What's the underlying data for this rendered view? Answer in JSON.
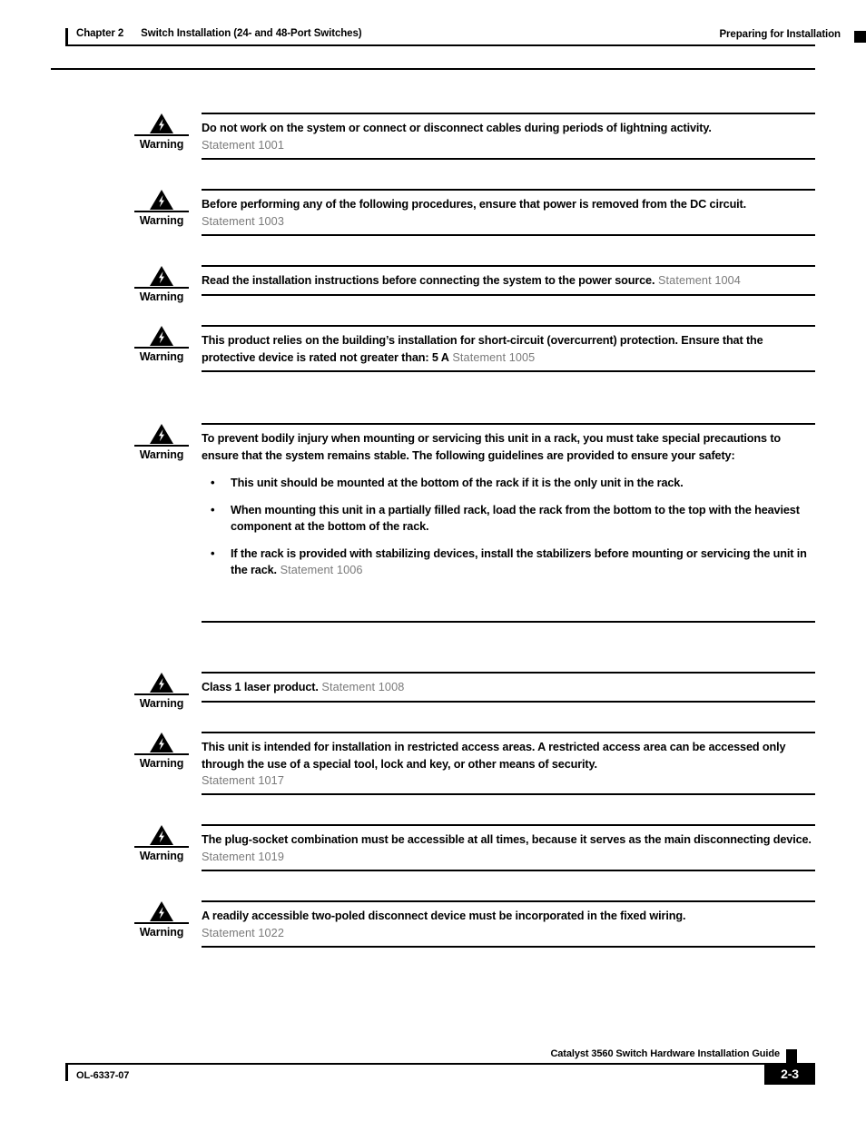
{
  "header": {
    "chapter_label": "Chapter 2",
    "chapter_title": "Switch Installation (24- and 48-Port Switches)",
    "section_title": "Preparing for Installation"
  },
  "warning_label": "Warning",
  "warnings": [
    {
      "id": "warning-1001",
      "text": "Do not work on the system or connect or disconnect cables during periods of lightning activity.",
      "statement": "Statement 1001",
      "statement_inline": false
    },
    {
      "id": "warning-1003",
      "text": "Before performing any of the following procedures, ensure that power is removed from the DC circuit.",
      "statement": "Statement 1003",
      "statement_inline": false
    },
    {
      "id": "warning-1004",
      "text": "Read the installation instructions before connecting the system to the power source.",
      "statement": "Statement 1004",
      "statement_inline": true
    },
    {
      "id": "warning-1005",
      "text": "This product relies on the building’s installation for short-circuit (overcurrent) protection. Ensure that the protective device is rated not greater than: 5 A",
      "statement": "Statement 1005",
      "statement_inline": true
    },
    {
      "id": "warning-1006",
      "text": "To prevent bodily injury when mounting or servicing this unit in a rack, you must take special precautions to ensure that the system remains stable. The following guidelines are provided to ensure your safety:",
      "bullets": [
        "This unit should be mounted at the bottom of the rack if it is the only unit in the rack.",
        "When mounting this unit in a partially filled rack, load the rack from the bottom to the top with the heaviest component at the bottom of the rack.",
        "If the rack is provided with stabilizing devices, install the stabilizers before mounting or servicing the unit in the rack."
      ],
      "statement": "Statement 1006",
      "statement_inline": true
    },
    {
      "id": "warning-1008",
      "text": "Class 1 laser product.",
      "statement": "Statement 1008",
      "statement_inline": true
    },
    {
      "id": "warning-1017",
      "text": "This unit is intended for installation in restricted access areas. A restricted access area can be accessed only through the use of a special tool, lock and key, or other means of security.",
      "statement": "Statement 1017",
      "statement_inline": false
    },
    {
      "id": "warning-1019",
      "text": "The plug-socket combination must be accessible at all times, because it serves as the main disconnecting device.",
      "statement": "Statement 1019",
      "statement_inline": true
    },
    {
      "id": "warning-1022",
      "text": "A readily accessible two-poled disconnect device must be incorporated in the fixed wiring.",
      "statement": "Statement 1022",
      "statement_inline": false
    }
  ],
  "bullet_glyph": "•",
  "footer": {
    "guide_title": "Catalyst 3560 Switch Hardware Installation Guide",
    "document_number": "OL-6337-07",
    "page_number": "2-3"
  }
}
